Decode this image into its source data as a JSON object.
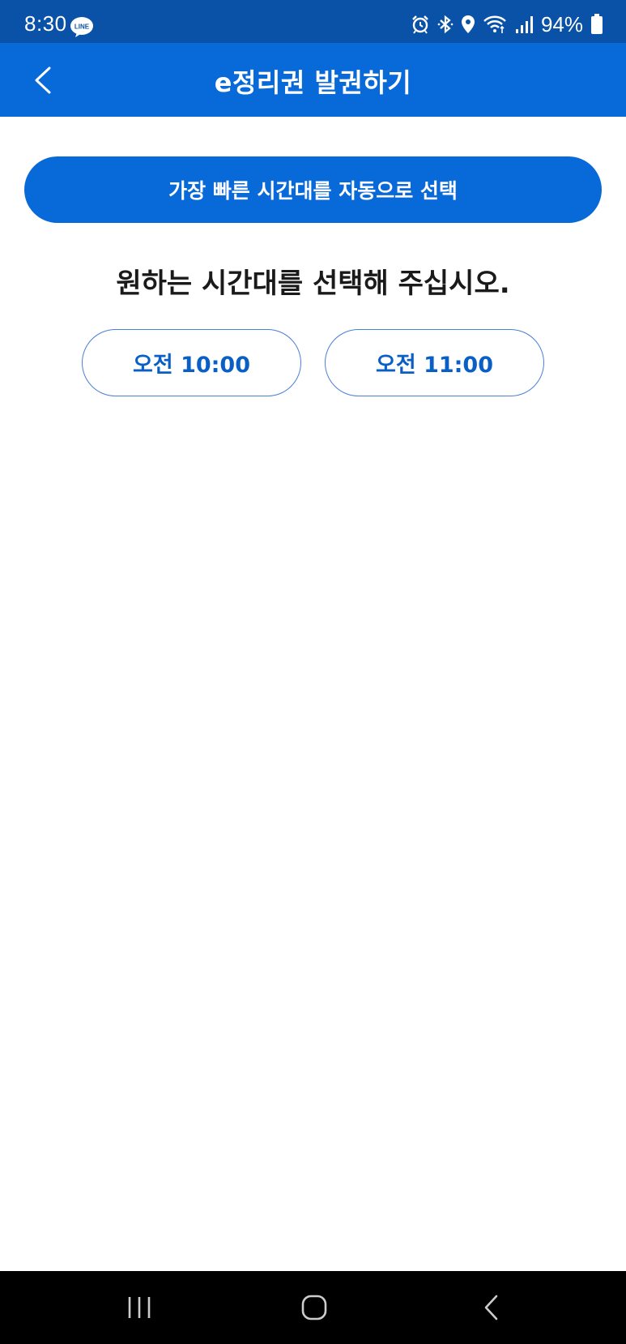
{
  "status_bar": {
    "time": "8:30",
    "line_label": "LINE",
    "battery_pct": "94%",
    "icons": [
      "line-icon",
      "alarm-icon",
      "bluetooth-icon",
      "location-icon",
      "wifi-icon",
      "signal-icon",
      "battery-icon"
    ]
  },
  "header": {
    "title": "e정리권 발권하기",
    "back_icon": "chevron-left-icon"
  },
  "main": {
    "auto_select_label": "가장 빠른 시간대를 자동으로 선택",
    "instruction": "원하는 시간대를 선택해 주십시오.",
    "time_slots": [
      {
        "label": "오전 10:00"
      },
      {
        "label": "오전 11:00"
      }
    ]
  },
  "nav_bar": {
    "icons": [
      "recent-apps-icon",
      "home-icon",
      "back-icon"
    ]
  },
  "colors": {
    "status_bar": "#0a52a8",
    "header": "#0869d8",
    "accent": "#0869d8",
    "slot_text": "#0a5fc7",
    "slot_border": "#4a7fd6",
    "nav_bar": "#000000"
  }
}
